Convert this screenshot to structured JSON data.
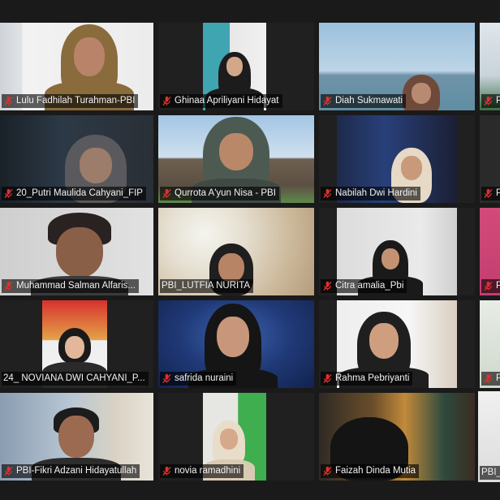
{
  "meeting": {
    "participants": [
      {
        "name": "Lulu Fadhilah Turahman-PBI",
        "muted": true
      },
      {
        "name": "Ghinaa Apriliyani Hidayat",
        "muted": true
      },
      {
        "name": "Diah Sukmawati",
        "muted": true
      },
      {
        "name": "P",
        "muted": true
      },
      {
        "name": "20_Putri Maulida Cahyani_FIP",
        "muted": true
      },
      {
        "name": "Qurrota A'yun Nisa - PBI",
        "muted": true
      },
      {
        "name": "Nabilah Dwi Hardini",
        "muted": true
      },
      {
        "name": "P",
        "muted": true
      },
      {
        "name": "Muhammad Salman Alfaris...",
        "muted": true
      },
      {
        "name": "PBI_LUTFIA NURITA",
        "muted": false
      },
      {
        "name": "Citra amalia_Pbi",
        "muted": true
      },
      {
        "name": "P",
        "muted": true
      },
      {
        "name": "24_ NOVIANA DWI CAHYANI_P...",
        "muted": false
      },
      {
        "name": "safrida nuraini",
        "muted": true
      },
      {
        "name": "Rahma Pebriyanti",
        "muted": true
      },
      {
        "name": "P",
        "muted": true
      },
      {
        "name": "PBI-Fikri Adzani Hidayatullah",
        "muted": true
      },
      {
        "name": "novia ramadhini",
        "muted": true
      },
      {
        "name": "Faizah Dinda Mutia",
        "muted": true
      },
      {
        "name": "PBI_",
        "muted": false
      }
    ],
    "colors": {
      "muted_icon": "#e0302c",
      "active_speaker_border": "#c9e265",
      "background": "#1a1a1a"
    }
  }
}
